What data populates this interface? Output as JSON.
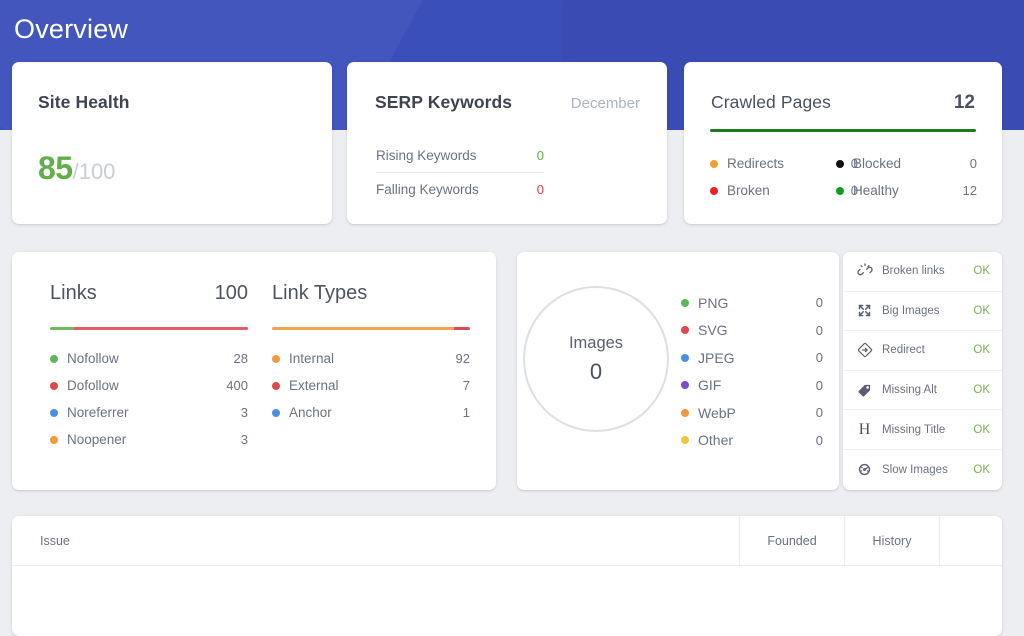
{
  "header": {
    "title": "Overview",
    "background_color": "#3b4fbb"
  },
  "site_health": {
    "title": "Site Health",
    "score": "85",
    "denominator": "/100",
    "score_color": "#63ad4b"
  },
  "serp_keywords": {
    "title": "SERP Keywords",
    "period": "December",
    "rows": [
      {
        "label": "Rising Keywords",
        "value": "0",
        "value_color": "#63ad4b"
      },
      {
        "label": "Falling Keywords",
        "value": "0",
        "value_color": "#d9434a"
      }
    ]
  },
  "crawled_pages": {
    "title": "Crawled Pages",
    "total": "12",
    "bar_color": "#1f7a1f",
    "bar_percent": 100,
    "left_column": [
      {
        "label": "Redirects",
        "value": "0",
        "color": "#f0a030"
      },
      {
        "label": "Broken",
        "value": "0",
        "color": "#e8212b"
      }
    ],
    "right_column": [
      {
        "label": "Blocked",
        "value": "0",
        "color": "#101010"
      },
      {
        "label": "Healthy",
        "value": "12",
        "color": "#129b22"
      }
    ]
  },
  "links": {
    "title": "Links",
    "total": "100",
    "bar_segments": [
      {
        "color": "#72b85c",
        "percent": 12
      },
      {
        "color": "#e35d62",
        "percent": 88
      }
    ],
    "rows": [
      {
        "label": "Nofollow",
        "value": "28",
        "color": "#5cb85c"
      },
      {
        "label": "Dofollow",
        "value": "400",
        "color": "#dc4a4a"
      },
      {
        "label": "Noreferrer",
        "value": "3",
        "color": "#4a90e2"
      },
      {
        "label": "Noopener",
        "value": "3",
        "color": "#ef9a3c"
      }
    ]
  },
  "link_types": {
    "title": "Link Types",
    "total": "",
    "bar_segments": [
      {
        "color": "#f0a44e",
        "percent": 92
      },
      {
        "color": "#d84a5c",
        "percent": 8
      }
    ],
    "rows": [
      {
        "label": "Internal",
        "value": "92",
        "color": "#ef9a3c"
      },
      {
        "label": "External",
        "value": "7",
        "color": "#dc4a4a"
      },
      {
        "label": "Anchor",
        "value": "1",
        "color": "#4a90e2"
      }
    ]
  },
  "images": {
    "donut_label": "Images",
    "donut_value": "0",
    "ring_color": "#dcdfe4",
    "rows": [
      {
        "label": "PNG",
        "value": "0",
        "color": "#5cb85c"
      },
      {
        "label": "SVG",
        "value": "0",
        "color": "#dc4a4a"
      },
      {
        "label": "JPEG",
        "value": "0",
        "color": "#4a90e2"
      },
      {
        "label": "GIF",
        "value": "0",
        "color": "#7a4ccc"
      },
      {
        "label": "WebP",
        "value": "0",
        "color": "#ef9a3c"
      },
      {
        "label": "Other",
        "value": "0",
        "color": "#efc53c"
      }
    ]
  },
  "checklist": {
    "status_color": "#77b255",
    "rows": [
      {
        "icon": "broken-link-icon",
        "label": "Broken links",
        "status": "OK"
      },
      {
        "icon": "expand-arrows-icon",
        "label": "Big Images",
        "status": "OK"
      },
      {
        "icon": "redirect-icon",
        "label": "Redirect",
        "status": "OK"
      },
      {
        "icon": "tag-icon",
        "label": "Missing Alt",
        "status": "OK"
      },
      {
        "icon": "heading-h-icon",
        "label": "Missing Title",
        "status": "OK"
      },
      {
        "icon": "speedometer-icon",
        "label": "Slow Images",
        "status": "OK"
      }
    ]
  },
  "issues_table": {
    "columns": [
      "Issue",
      "Founded",
      "History",
      ""
    ]
  }
}
